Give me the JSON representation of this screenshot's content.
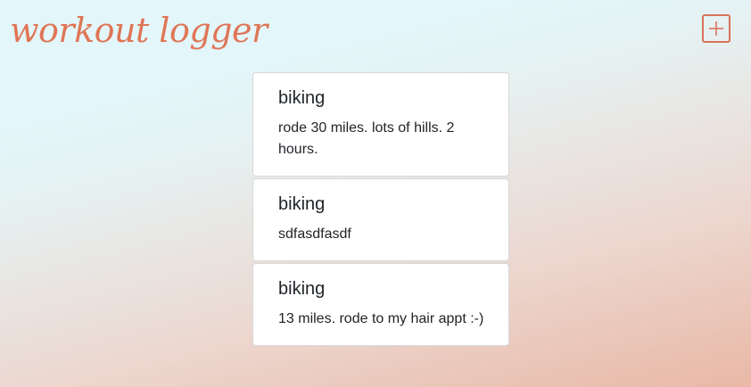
{
  "header": {
    "title": "workout logger",
    "add_button_icon": "plus-square-icon",
    "accent_color": "#df7656"
  },
  "entries": [
    {
      "title": "biking",
      "description": "rode 30 miles. lots of hills. 2 hours."
    },
    {
      "title": "biking",
      "description": "sdfasdfasdf"
    },
    {
      "title": "biking",
      "description": "13 miles. rode to my hair appt :-)"
    }
  ]
}
